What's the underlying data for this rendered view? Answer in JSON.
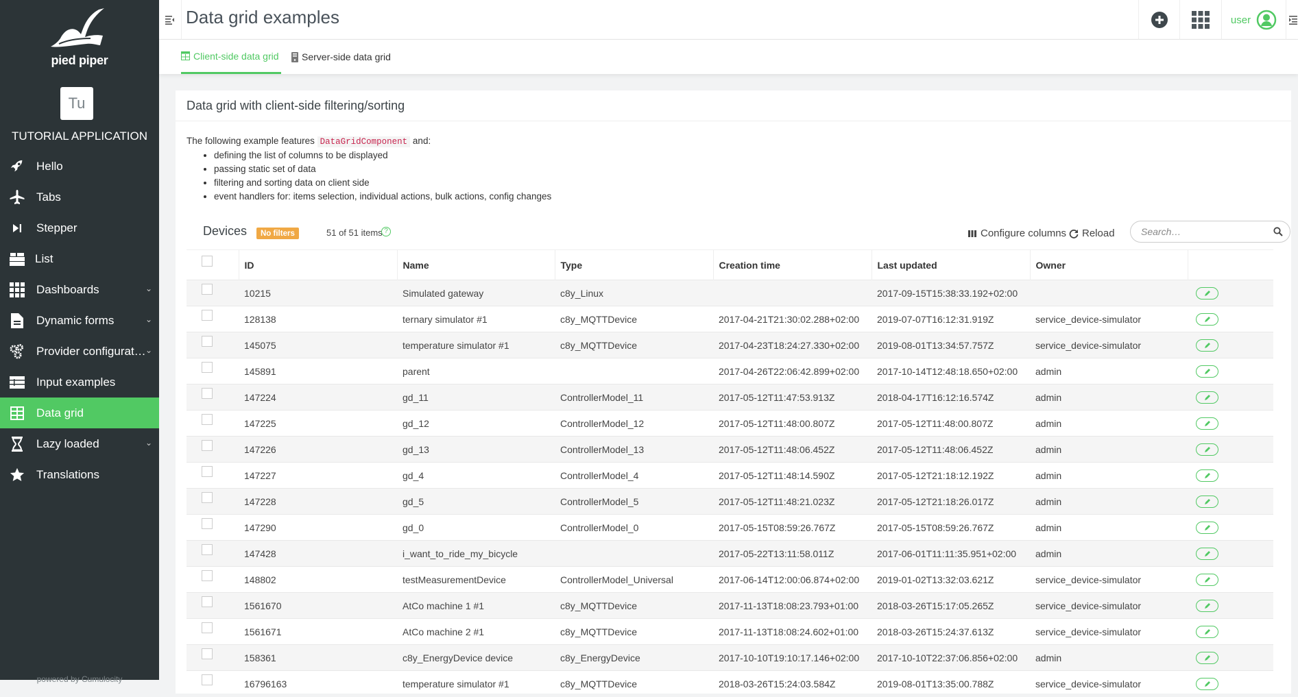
{
  "sidebar": {
    "logo_text": "pied piper",
    "app_icon": "Tu",
    "app_name": "TUTORIAL APPLICATION",
    "items": [
      {
        "label": "Hello",
        "icon": "rocket-icon",
        "expandable": false,
        "active": false
      },
      {
        "label": "Tabs",
        "icon": "plane-icon",
        "expandable": false,
        "active": false
      },
      {
        "label": "Stepper",
        "icon": "step-forward-icon",
        "expandable": false,
        "active": false
      },
      {
        "label": "List",
        "icon": "list-blocks-icon",
        "expandable": false,
        "active": false
      },
      {
        "label": "Dashboards",
        "icon": "grid-icon",
        "expandable": true,
        "active": false
      },
      {
        "label": "Dynamic forms",
        "icon": "document-icon",
        "expandable": true,
        "active": false
      },
      {
        "label": "Provider configurat…",
        "icon": "cogs-icon",
        "expandable": true,
        "active": false
      },
      {
        "label": "Input examples",
        "icon": "form-list-icon",
        "expandable": false,
        "active": false
      },
      {
        "label": "Data grid",
        "icon": "table-icon",
        "expandable": false,
        "active": true
      },
      {
        "label": "Lazy loaded",
        "icon": "hourglass-icon",
        "expandable": true,
        "active": false
      },
      {
        "label": "Translations",
        "icon": "star-icon",
        "expandable": false,
        "active": false
      }
    ],
    "footer": "powered by Cumulocity"
  },
  "header": {
    "title": "Data grid examples",
    "user_label": "user"
  },
  "tabs": [
    {
      "label": "Client-side data grid",
      "icon": "table-icon",
      "active": true
    },
    {
      "label": "Server-side data grid",
      "icon": "server-icon",
      "active": false
    }
  ],
  "card": {
    "title": "Data grid with client-side filtering/sorting",
    "intro_prefix": "The following example features",
    "intro_code": "DataGridComponent",
    "intro_suffix": "and:",
    "bullets": [
      "defining the list of columns to be displayed",
      "passing static set of data",
      "filtering and sorting data on client side",
      "event handlers for: items selection, individual actions, bulk actions, config changes"
    ]
  },
  "grid": {
    "title": "Devices",
    "filter_badge": "No filters",
    "count": "51 of 51 items",
    "configure_label": "Configure columns",
    "reload_label": "Reload",
    "search_placeholder": "Search…",
    "columns": [
      "ID",
      "Name",
      "Type",
      "Creation time",
      "Last updated",
      "Owner"
    ],
    "rows": [
      [
        "10215",
        "Simulated gateway",
        "c8y_Linux",
        "",
        "2017-09-15T15:38:33.192+02:00",
        ""
      ],
      [
        "128138",
        "ternary simulator #1",
        "c8y_MQTTDevice",
        "2017-04-21T21:30:02.288+02:00",
        "2019-07-07T16:12:31.919Z",
        "service_device-simulator"
      ],
      [
        "145075",
        "temperature simulator #1",
        "c8y_MQTTDevice",
        "2017-04-23T18:24:27.330+02:00",
        "2019-08-01T13:34:57.757Z",
        "service_device-simulator"
      ],
      [
        "145891",
        "parent",
        "",
        "2017-04-26T22:06:42.899+02:00",
        "2017-10-14T12:48:18.650+02:00",
        "admin"
      ],
      [
        "147224",
        "gd_11",
        "ControllerModel_11",
        "2017-05-12T11:47:53.913Z",
        "2018-04-17T16:12:16.574Z",
        "admin"
      ],
      [
        "147225",
        "gd_12",
        "ControllerModel_12",
        "2017-05-12T11:48:00.807Z",
        "2017-05-12T11:48:00.807Z",
        "admin"
      ],
      [
        "147226",
        "gd_13",
        "ControllerModel_13",
        "2017-05-12T11:48:06.452Z",
        "2017-05-12T11:48:06.452Z",
        "admin"
      ],
      [
        "147227",
        "gd_4",
        "ControllerModel_4",
        "2017-05-12T11:48:14.590Z",
        "2017-05-12T21:18:12.192Z",
        "admin"
      ],
      [
        "147228",
        "gd_5",
        "ControllerModel_5",
        "2017-05-12T11:48:21.023Z",
        "2017-05-12T21:18:26.017Z",
        "admin"
      ],
      [
        "147290",
        "gd_0",
        "ControllerModel_0",
        "2017-05-15T08:59:26.767Z",
        "2017-05-15T08:59:26.767Z",
        "admin"
      ],
      [
        "147428",
        "i_want_to_ride_my_bicycle",
        "",
        "2017-05-22T13:11:58.011Z",
        "2017-06-01T11:11:35.951+02:00",
        "admin"
      ],
      [
        "148802",
        "testMeasurementDevice",
        "ControllerModel_Universal",
        "2017-06-14T12:00:06.874+02:00",
        "2019-01-02T13:32:03.621Z",
        "service_device-simulator"
      ],
      [
        "1561670",
        "AtCo machine 1 #1",
        "c8y_MQTTDevice",
        "2017-11-13T18:08:23.793+01:00",
        "2018-03-26T15:17:05.265Z",
        "service_device-simulator"
      ],
      [
        "1561671",
        "AtCo machine 2 #1",
        "c8y_MQTTDevice",
        "2017-11-13T18:08:24.602+01:00",
        "2018-03-26T15:24:37.613Z",
        "service_device-simulator"
      ],
      [
        "158361",
        "c8y_EnergyDevice device",
        "c8y_EnergyDevice",
        "2017-10-10T19:10:17.146+02:00",
        "2017-10-10T22:37:06.856+02:00",
        "admin"
      ],
      [
        "16796163",
        "temperature simulator #1",
        "c8y_MQTTDevice",
        "2018-03-26T15:24:03.584Z",
        "2019-08-01T13:35:00.788Z",
        "service_device-simulator"
      ]
    ]
  },
  "colors": {
    "accent": "#51c963",
    "sidebar_bg": "#2c3437",
    "badge": "#f0a844"
  }
}
